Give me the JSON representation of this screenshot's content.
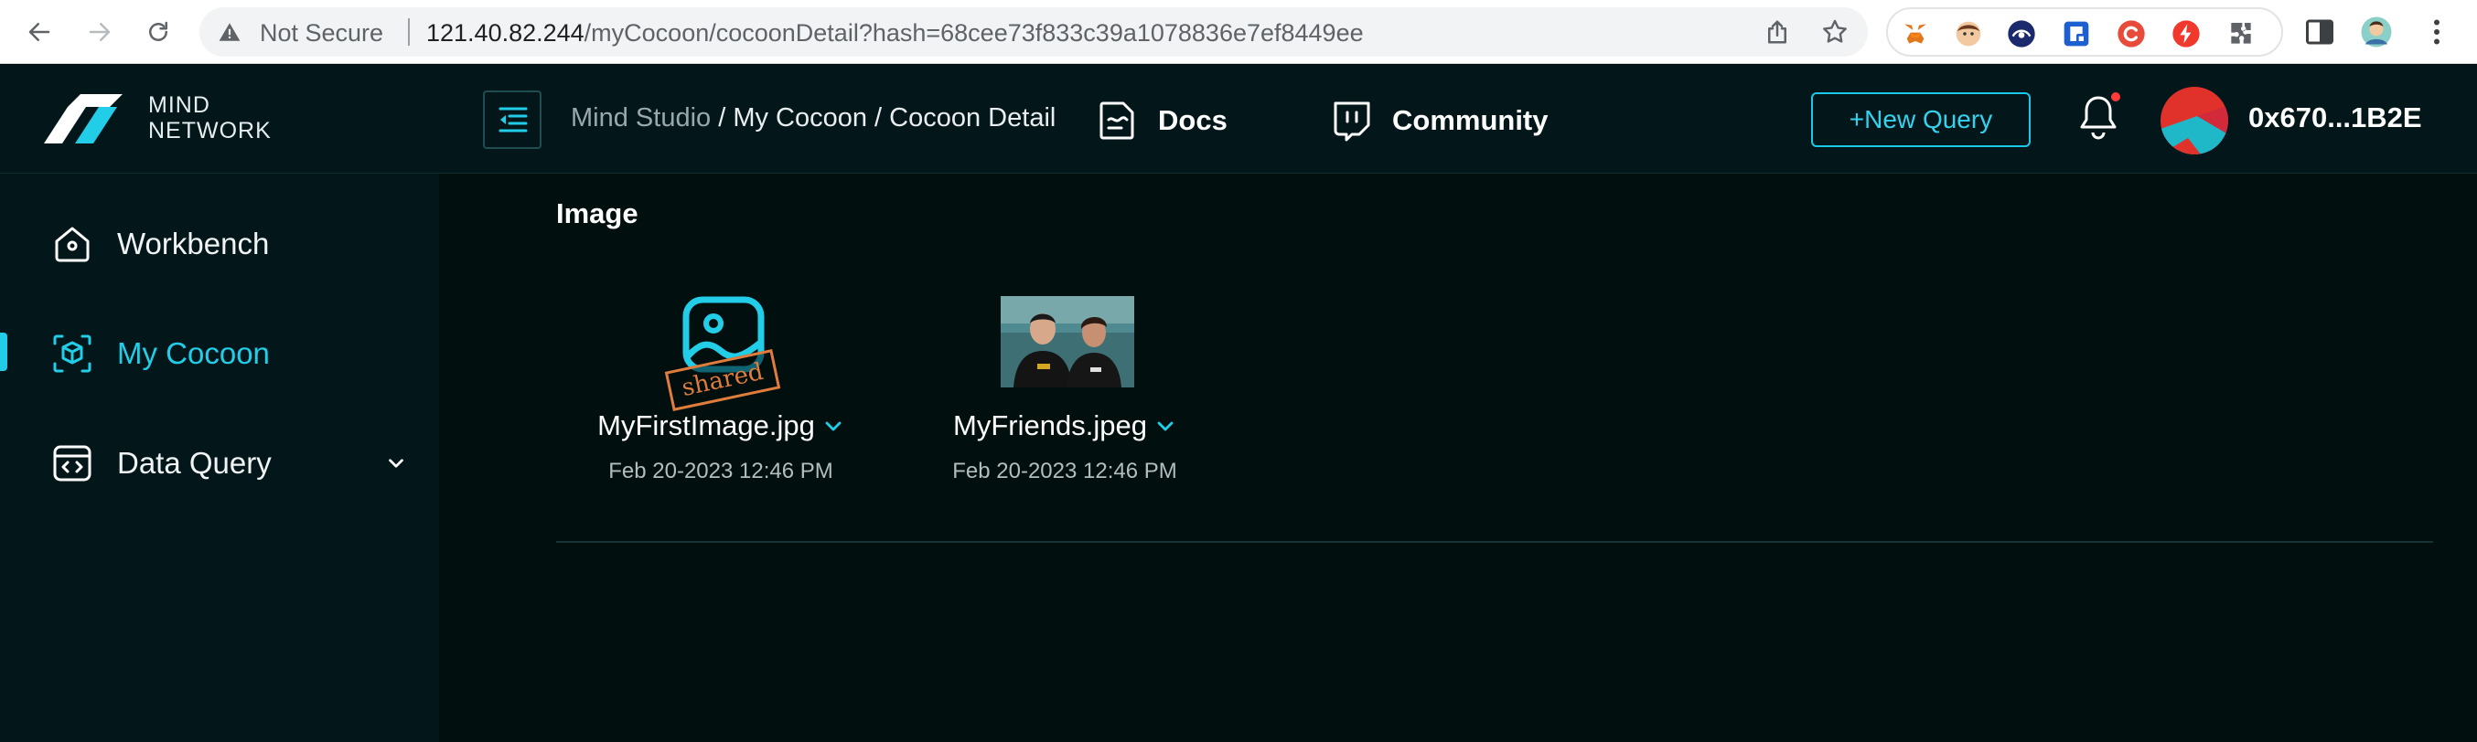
{
  "browser": {
    "security_label": "Not Secure",
    "url_host": "121.40.82.244",
    "url_path": "/myCocoon/cocoonDetail?hash=68cee73f833c39a1078836e7ef8449ee"
  },
  "brand": {
    "line1": "MIND",
    "line2": "NETWORK"
  },
  "breadcrumb": {
    "root": "Mind Studio",
    "sep1": " / ",
    "middle": "My Cocoon",
    "sep2": " / ",
    "current": "Cocoon Detail"
  },
  "header": {
    "docs_label": "Docs",
    "community_label": "Community",
    "new_query_label": "+New Query",
    "wallet_address": "0x670...1B2E"
  },
  "sidebar": {
    "items": [
      {
        "label": "Workbench",
        "icon": "home-icon"
      },
      {
        "label": "My Cocoon",
        "icon": "cube-icon",
        "active": true
      },
      {
        "label": "Data Query",
        "icon": "code-window-icon",
        "expandable": true
      }
    ]
  },
  "main": {
    "section_title": "Image",
    "files": [
      {
        "name": "MyFirstImage.jpg",
        "date": "Feb 20-2023 12:46 PM",
        "thumbnail": "image-placeholder-icon",
        "stamp": "shared"
      },
      {
        "name": "MyFriends.jpeg",
        "date": "Feb 20-2023 12:46 PM",
        "thumbnail": "photo-thumbnail"
      }
    ]
  },
  "colors": {
    "accent": "#22cde8",
    "background": "#020f0f",
    "sidebar_bg": "#03171a",
    "stamp": "#e07d3c",
    "notification_dot": "#ff3b3b"
  }
}
